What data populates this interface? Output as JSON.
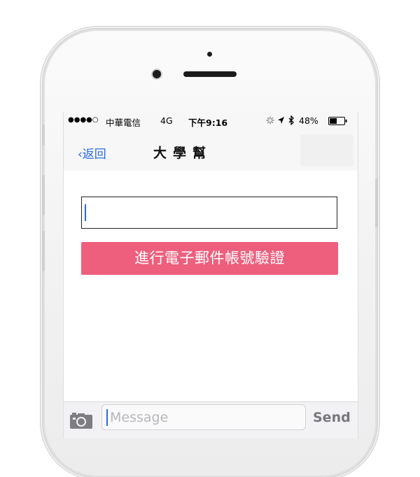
{
  "status_bar": {
    "signal": "●●●●○",
    "carrier": "中華電信",
    "network": "4G",
    "time": "下午9:16",
    "battery_percent": "48%"
  },
  "nav": {
    "back_label": "‹返回",
    "title": "大學幫"
  },
  "form": {
    "email_value": "",
    "verify_button_label": "進行電子郵件帳號驗證"
  },
  "message_bar": {
    "placeholder": "Message",
    "send_label": "Send"
  },
  "colors": {
    "accent": "#2a6ae0",
    "verify_button": "#ee5f7d"
  },
  "icons": [
    "camera-icon",
    "location-arrow-icon",
    "bluetooth-icon",
    "battery-icon",
    "activity-spinner-icon"
  ]
}
